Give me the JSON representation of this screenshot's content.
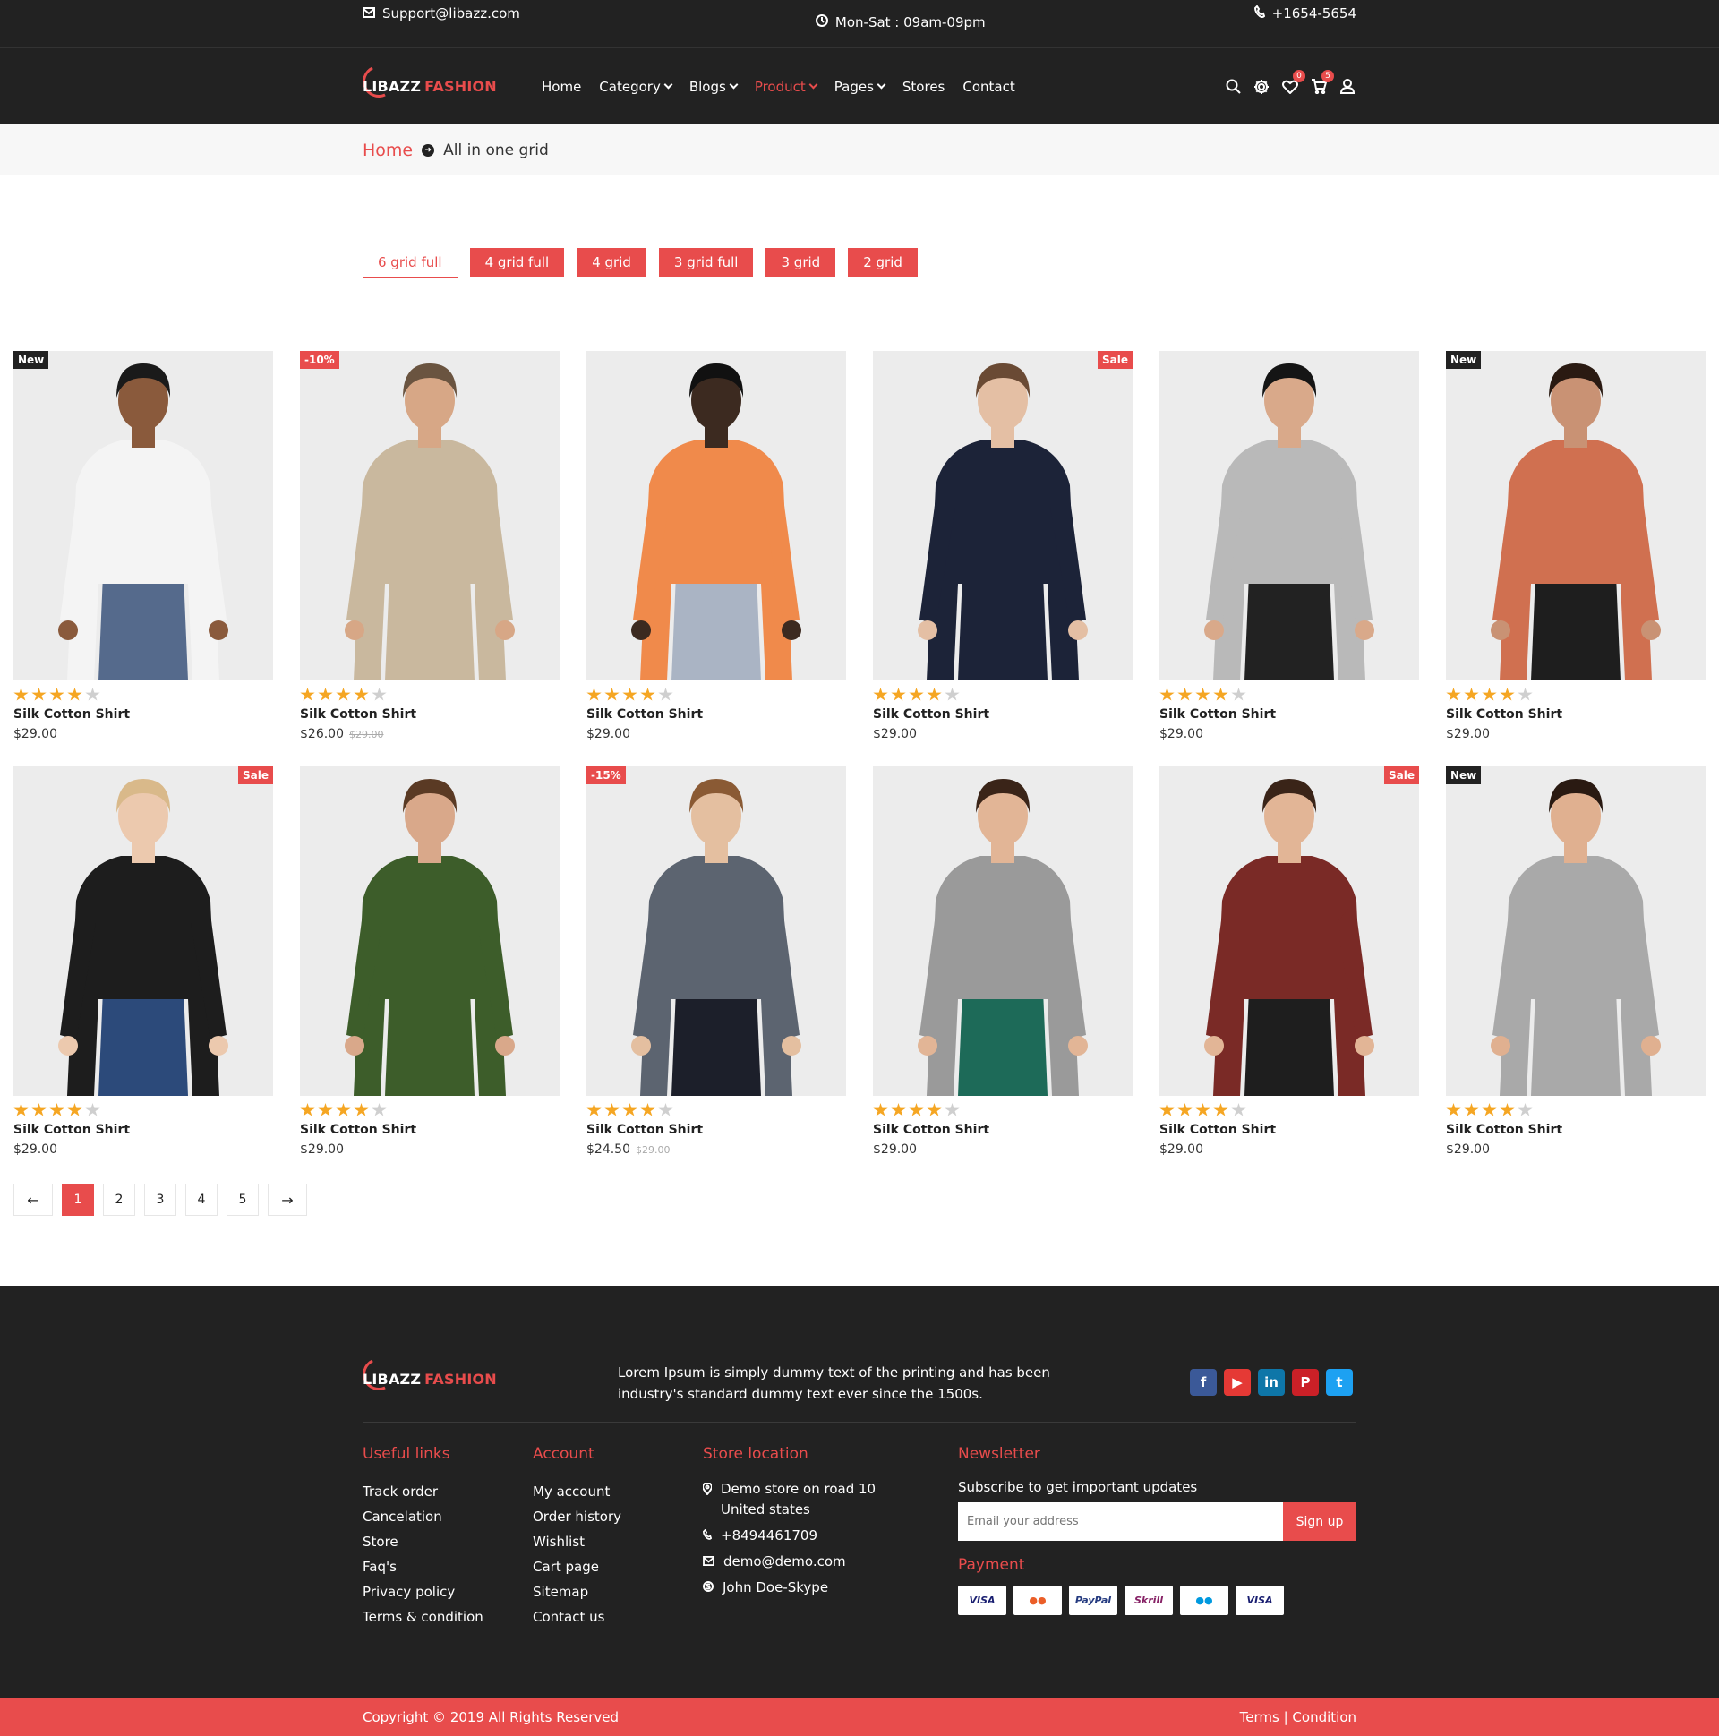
{
  "topbar": {
    "email": "Support@libazz.com",
    "hours": "Mon-Sat : 09am-09pm",
    "phone": "+1654-5654"
  },
  "brand": {
    "part1": "LIBAZZ",
    "part2": "FASHION",
    "accent": "#e84c4c",
    "dark": "#222222"
  },
  "nav": [
    {
      "label": "Home",
      "dropdown": false,
      "active": false
    },
    {
      "label": "Category",
      "dropdown": true,
      "active": false
    },
    {
      "label": "Blogs",
      "dropdown": true,
      "active": false
    },
    {
      "label": "Product",
      "dropdown": true,
      "active": true
    },
    {
      "label": "Pages",
      "dropdown": true,
      "active": false
    },
    {
      "label": "Stores",
      "dropdown": false,
      "active": false
    },
    {
      "label": "Contact",
      "dropdown": false,
      "active": false
    }
  ],
  "header_icons": {
    "search": "search-icon",
    "settings": "gear-icon",
    "wishlist": "heart-icon",
    "wishlist_count": "0",
    "cart": "cart-icon",
    "cart_count": "5",
    "account": "user-icon"
  },
  "breadcrumb": {
    "home": "Home",
    "current": "All in one grid"
  },
  "grid_tabs": [
    "6 grid full",
    "4 grid full",
    "4 grid",
    "3 grid full",
    "3 grid",
    "2 grid"
  ],
  "active_tab": "6 grid full",
  "products": [
    {
      "name": "Silk Cotton Shirt",
      "price": "$29.00",
      "old_price": "",
      "badge": "New",
      "badge_side": "left",
      "badge_style": "dark",
      "rating": 4,
      "art": {
        "shirt": "#f4f4f4",
        "skin": "#8a5a3c",
        "pants": "#556a8c",
        "hair": "#1a1a1a"
      }
    },
    {
      "name": "Silk Cotton Shirt",
      "price": "$26.00",
      "old_price": "$29.00",
      "badge": "-10%",
      "badge_side": "left",
      "badge_style": "red",
      "rating": 4,
      "art": {
        "shirt": "#c9b89e",
        "skin": "#d7a786",
        "pants": "#c9b89e",
        "hair": "#6a5440"
      }
    },
    {
      "name": "Silk Cotton Shirt",
      "price": "$29.00",
      "old_price": "",
      "badge": "",
      "badge_side": "left",
      "badge_style": "dark",
      "rating": 4,
      "art": {
        "shirt": "#f08a4b",
        "skin": "#3c2a20",
        "pants": "#aab4c4",
        "hair": "#111111"
      }
    },
    {
      "name": "Silk Cotton Shirt",
      "price": "$29.00",
      "old_price": "",
      "badge": "Sale",
      "badge_side": "right",
      "badge_style": "red",
      "rating": 4,
      "art": {
        "shirt": "#1c2338",
        "skin": "#e4bfa4",
        "pants": "#1c2338",
        "hair": "#6a4a34"
      }
    },
    {
      "name": "Silk Cotton Shirt",
      "price": "$29.00",
      "old_price": "",
      "badge": "",
      "badge_side": "left",
      "badge_style": "dark",
      "rating": 4,
      "art": {
        "shirt": "#b9b9b9",
        "skin": "#d9a98a",
        "pants": "#222222",
        "hair": "#151515"
      }
    },
    {
      "name": "Silk Cotton Shirt",
      "price": "$29.00",
      "old_price": "",
      "badge": "New",
      "badge_side": "left",
      "badge_style": "dark",
      "rating": 4,
      "art": {
        "shirt": "#d07050",
        "skin": "#c99274",
        "pants": "#1e1e1e",
        "hair": "#2a1a12"
      }
    },
    {
      "name": "Silk Cotton Shirt",
      "price": "$29.00",
      "old_price": "",
      "badge": "Sale",
      "badge_side": "right",
      "badge_style": "red",
      "rating": 4,
      "art": {
        "shirt": "#1d1d1d",
        "skin": "#ecc9ae",
        "pants": "#2c4a7a",
        "hair": "#d9b98a"
      }
    },
    {
      "name": "Silk Cotton Shirt",
      "price": "$29.00",
      "old_price": "",
      "badge": "",
      "badge_side": "left",
      "badge_style": "dark",
      "rating": 4,
      "art": {
        "shirt": "#3d5d2a",
        "skin": "#d9a88a",
        "pants": "#3d5d2a",
        "hair": "#5a3a24"
      }
    },
    {
      "name": "Silk Cotton Shirt",
      "price": "$24.50",
      "old_price": "$29.00",
      "badge": "-15%",
      "badge_side": "left",
      "badge_style": "red",
      "rating": 4,
      "art": {
        "shirt": "#5c6470",
        "skin": "#e4bfa0",
        "pants": "#1c1f2a",
        "hair": "#8a5a34"
      }
    },
    {
      "name": "Silk Cotton Shirt",
      "price": "$29.00",
      "old_price": "",
      "badge": "",
      "badge_side": "left",
      "badge_style": "dark",
      "rating": 4,
      "art": {
        "shirt": "#9a9a9a",
        "skin": "#e2b596",
        "pants": "#1d6a58",
        "hair": "#3a2418"
      }
    },
    {
      "name": "Silk Cotton Shirt",
      "price": "$29.00",
      "old_price": "",
      "badge": "Sale",
      "badge_side": "right",
      "badge_style": "red",
      "rating": 4,
      "art": {
        "shirt": "#7a2a26",
        "skin": "#e2b596",
        "pants": "#1e1e1e",
        "hair": "#3a2418"
      }
    },
    {
      "name": "Silk Cotton Shirt",
      "price": "$29.00",
      "old_price": "",
      "badge": "New",
      "badge_side": "left",
      "badge_style": "dark",
      "rating": 4,
      "art": {
        "shirt": "#a9a9a9",
        "skin": "#e0b090",
        "pants": "#a9a9a9",
        "hair": "#2a1a12"
      }
    }
  ],
  "pagination": {
    "prev": "←",
    "next": "→",
    "pages": [
      "1",
      "2",
      "3",
      "4",
      "5"
    ],
    "current": "1"
  },
  "footer": {
    "description": "Lorem Ipsum is simply dummy text of the printing and has been industry's standard dummy text ever since the 1500s.",
    "social": [
      {
        "name": "facebook-icon",
        "glyph": "f",
        "color": "#3b5998"
      },
      {
        "name": "youtube-icon",
        "glyph": "▶",
        "color": "#e53935"
      },
      {
        "name": "linkedin-icon",
        "glyph": "in",
        "color": "#0e76a8"
      },
      {
        "name": "pinterest-icon",
        "glyph": "P",
        "color": "#cb2027"
      },
      {
        "name": "twitter-icon",
        "glyph": "t",
        "color": "#1da1f2"
      }
    ],
    "useful_links": {
      "title": "Useful links",
      "items": [
        "Track order",
        "Cancelation",
        "Store",
        "Faq's",
        "Privacy policy",
        "Terms & condition"
      ]
    },
    "account": {
      "title": "Account",
      "items": [
        "My account",
        "Order history",
        "Wishlist",
        "Cart page",
        "Sitemap",
        "Contact us"
      ]
    },
    "store": {
      "title": "Store location",
      "address": "Demo store on road 10 United states",
      "phone": "+8494461709",
      "email": "demo@demo.com",
      "skype": "John Doe-Skype"
    },
    "newsletter": {
      "title": "Newsletter",
      "subtitle": "Subscribe to get important updates",
      "placeholder": "Email your address",
      "button": "Sign up"
    },
    "payment": {
      "title": "Payment",
      "cards": [
        {
          "label": "VISA",
          "color": "#1a1f71"
        },
        {
          "label": "●●",
          "color": "#eb5e28"
        },
        {
          "label": "PayPal",
          "color": "#253b80"
        },
        {
          "label": "Skrill",
          "color": "#862165"
        },
        {
          "label": "●●",
          "color": "#0099df"
        },
        {
          "label": "VISA",
          "color": "#1a1f71"
        }
      ]
    }
  },
  "copyright": {
    "text": "Copyright © 2019 All Rights Reserved",
    "terms": "Terms | Condition"
  }
}
